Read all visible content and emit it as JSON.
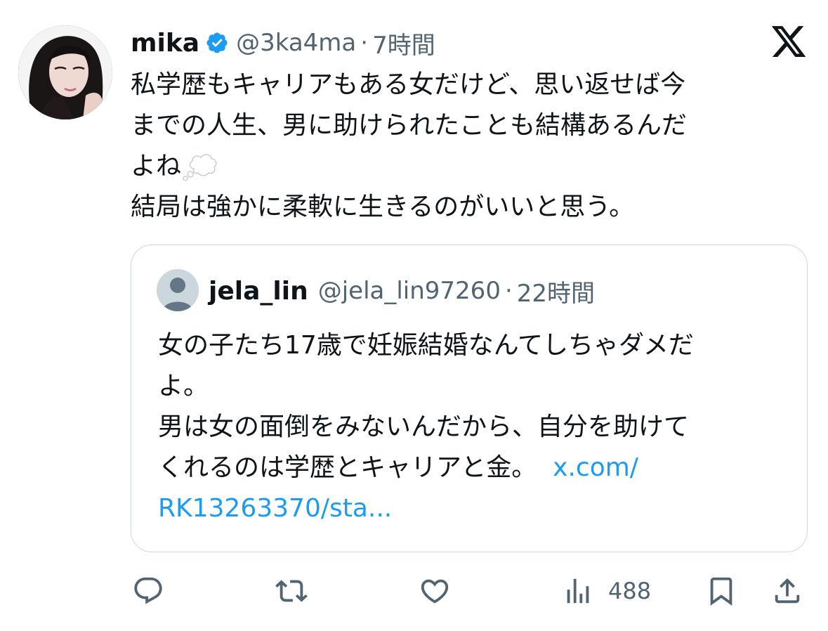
{
  "tweet": {
    "author_name": "mika",
    "verified": true,
    "handle": "@3ka4ma",
    "separator": "·",
    "time": "7時間",
    "lines": [
      "私学歴もキャリアもある女だけど、思い返せば今",
      "までの人生、男に助けられたことも結構あるんだ",
      "よね",
      "結局は強かに柔軟に生きるのがいいと思う。"
    ],
    "emoji_name": "thought-balloon"
  },
  "quote": {
    "author_name": "jela_lin",
    "handle": "@jela_lin97260",
    "separator": "·",
    "time": "22時間",
    "lines": [
      "女の子たち17歳で妊娠結婚なんてしちゃダメだ",
      "よ。",
      "男は女の面倒をみないんだから、自分を助けて",
      "くれるのは学歴とキャリアと金。"
    ],
    "link_part1": "x.com/",
    "link_part2": "RK13263370/sta..."
  },
  "actions": {
    "reply_icon": "reply-icon",
    "retweet_icon": "retweet-icon",
    "like_icon": "like-icon",
    "views_icon": "views-icon",
    "views_count": "488",
    "bookmark_icon": "bookmark-icon",
    "share_icon": "share-icon"
  },
  "colors": {
    "text": "#0f1419",
    "secondary": "#536471",
    "link": "#1d9bf0",
    "verified": "#1d9bf0",
    "border": "#cfd9de"
  }
}
